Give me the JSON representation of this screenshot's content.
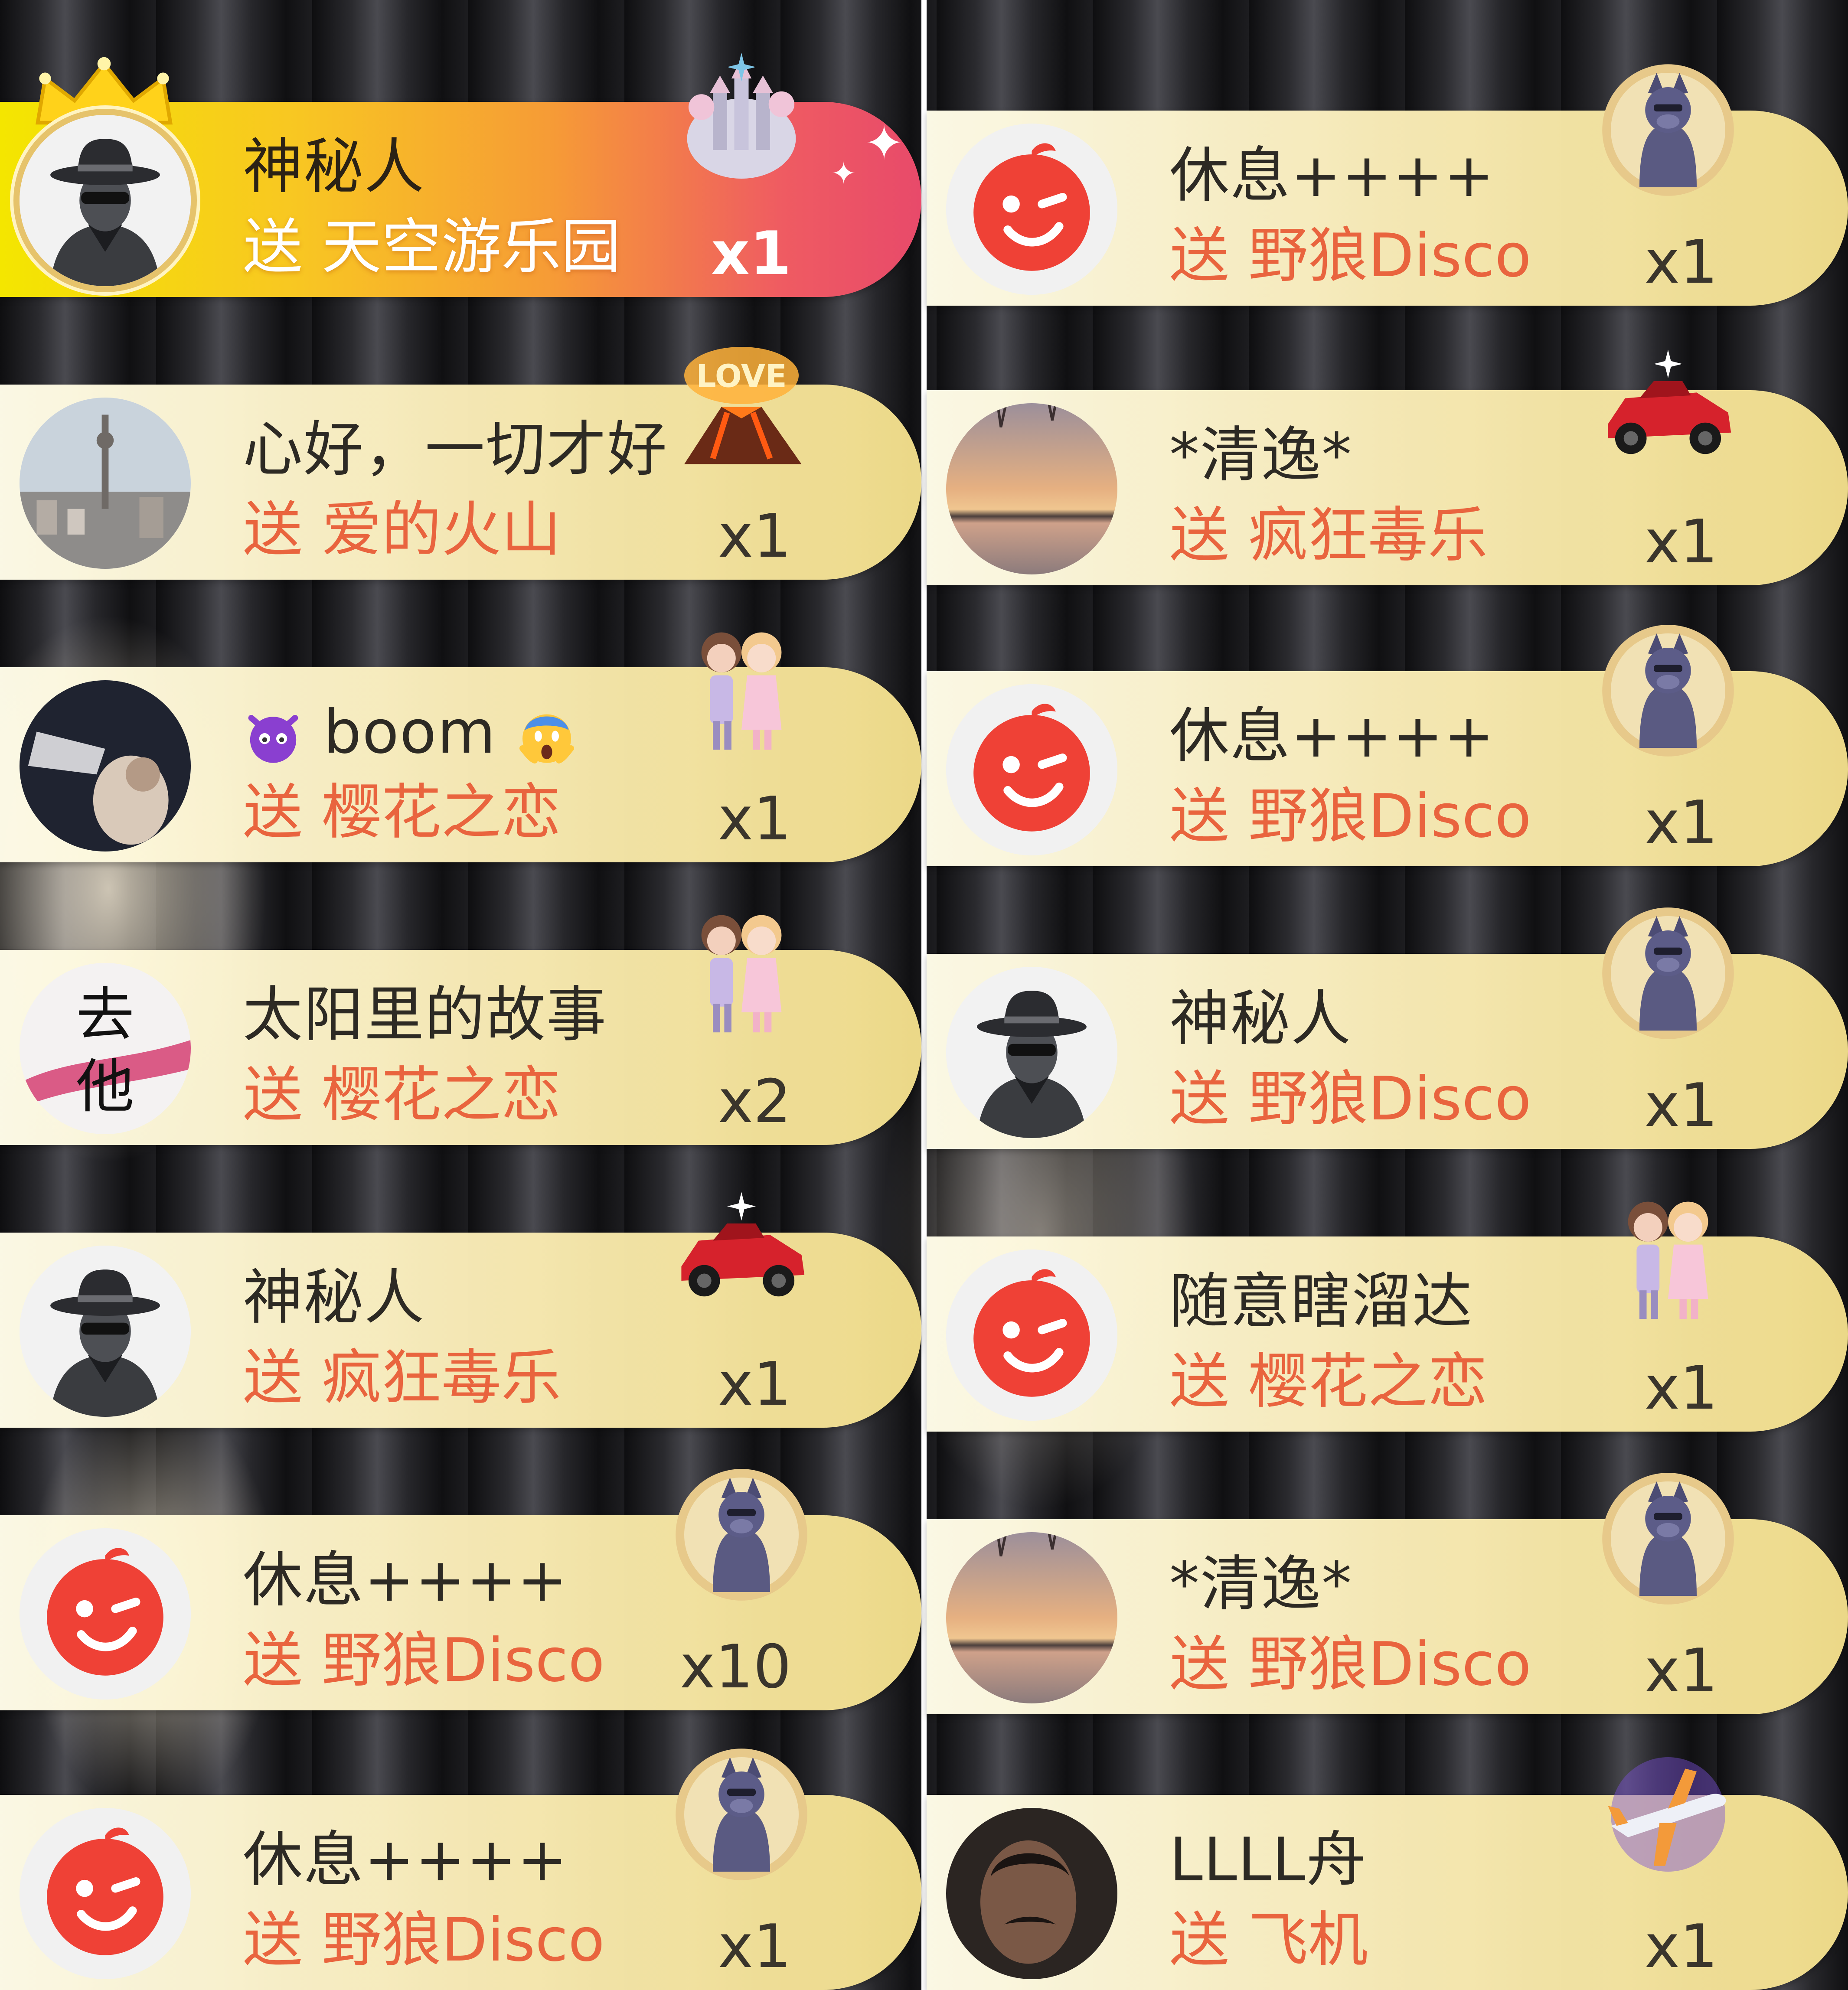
{
  "colors": {
    "name_text": "#2d2a24",
    "gift_text": "#e9643e",
    "highlight_gradient": [
      "#f4e600",
      "#f69b36",
      "#e84a6a"
    ]
  },
  "left_column": [
    {
      "name": "神秘人",
      "gift_text": "送 天空游乐园",
      "count": "x1",
      "avatar_icon": "mystery-man-avatar",
      "gift_icon": "sky-castle-gift-icon",
      "highlight": true
    },
    {
      "name": "心好，一切才好",
      "gift_text": "送 爱的火山",
      "count": "x1",
      "avatar_icon": "city-tower-avatar",
      "gift_icon": "love-volcano-gift-icon"
    },
    {
      "name": "boom",
      "gift_text": "送 樱花之恋",
      "count": "x1",
      "avatar_icon": "cat-hand-photo-avatar",
      "gift_icon": "couple-gift-icon"
    },
    {
      "name": "太阳里的故事",
      "gift_text": "送 樱花之恋",
      "count": "x2",
      "avatar_icon": "calligraphy-avatar",
      "gift_icon": "couple-gift-icon"
    },
    {
      "name": "神秘人",
      "gift_text": "送 疯狂毒乐",
      "count": "x1",
      "avatar_icon": "mystery-man-avatar",
      "gift_icon": "race-car-gift-icon"
    },
    {
      "name": "休息++++",
      "gift_text": "送 野狼Disco",
      "count": "x10",
      "avatar_icon": "red-wink-avatar",
      "gift_icon": "wolf-disco-gift-icon"
    },
    {
      "name": "休息++++",
      "gift_text": "送 野狼Disco",
      "count": "x1",
      "avatar_icon": "red-wink-avatar",
      "gift_icon": "wolf-disco-gift-icon"
    }
  ],
  "right_column": [
    {
      "name": "休息++++",
      "gift_text": "送 野狼Disco",
      "count": "x1",
      "avatar_icon": "red-wink-avatar",
      "gift_icon": "wolf-disco-gift-icon"
    },
    {
      "name": "*清逸*",
      "gift_text": "送 疯狂毒乐",
      "count": "x1",
      "avatar_icon": "sunset-lake-avatar",
      "gift_icon": "race-car-gift-icon"
    },
    {
      "name": "休息++++",
      "gift_text": "送 野狼Disco",
      "count": "x1",
      "avatar_icon": "red-wink-avatar",
      "gift_icon": "wolf-disco-gift-icon"
    },
    {
      "name": "神秘人",
      "gift_text": "送 野狼Disco",
      "count": "x1",
      "avatar_icon": "mystery-man-avatar",
      "gift_icon": "wolf-disco-gift-icon"
    },
    {
      "name": "随意瞎溜达",
      "gift_text": "送 樱花之恋",
      "count": "x1",
      "avatar_icon": "red-wink-avatar",
      "gift_icon": "couple-gift-icon"
    },
    {
      "name": "*清逸*",
      "gift_text": "送 野狼Disco",
      "count": "x1",
      "avatar_icon": "sunset-lake-avatar",
      "gift_icon": "wolf-disco-gift-icon"
    },
    {
      "name": "LLLL舟",
      "gift_text": "送 飞机",
      "count": "x1",
      "avatar_icon": "man-portrait-avatar",
      "gift_icon": "airplane-gift-icon"
    }
  ]
}
